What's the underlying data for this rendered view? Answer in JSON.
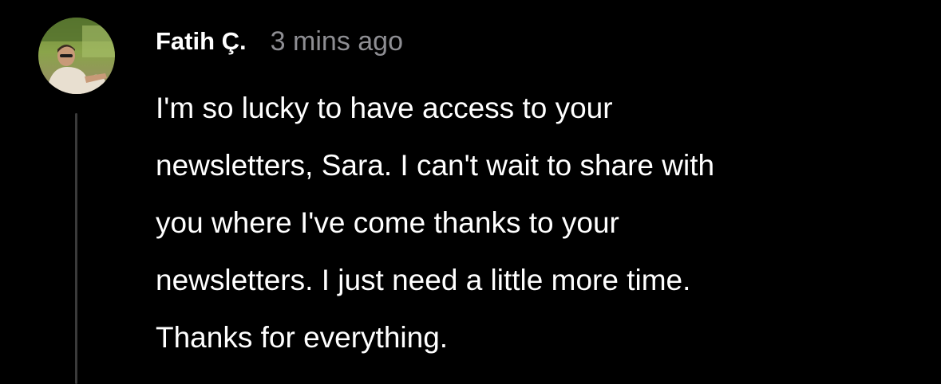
{
  "comment": {
    "author": "Fatih Ç.",
    "timestamp": "3 mins ago",
    "avatar_icon": "profile-photo",
    "text_lines": [
      "I'm so lucky to have access to your",
      "newsletters, Sara. I can't wait to share with",
      "you where I've come thanks to your",
      "newsletters. I just need a little more time.",
      "Thanks for everything."
    ]
  },
  "colors": {
    "background": "#000000",
    "text": "#ffffff",
    "muted": "#8e8e93",
    "thread_line": "#3a3a3a"
  }
}
